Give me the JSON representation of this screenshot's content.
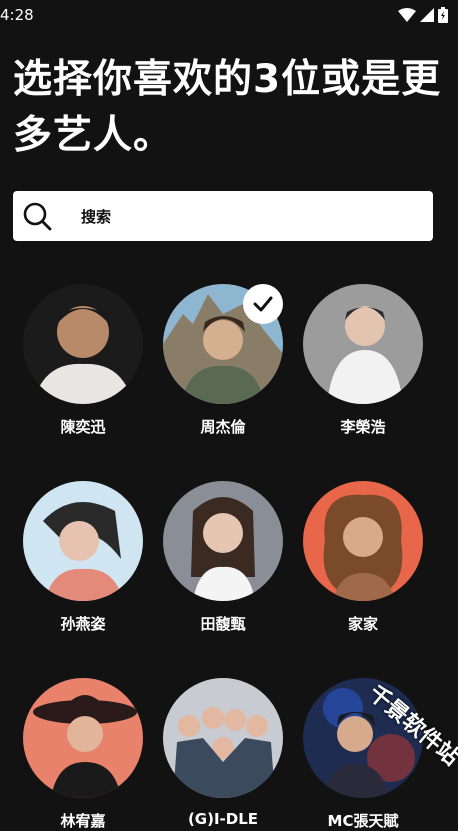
{
  "status": {
    "time": "4:28"
  },
  "title": "选择你喜欢的3位或是更多艺人。",
  "search": {
    "placeholder": "搜索"
  },
  "artists": [
    {
      "name": "陳奕迅",
      "selected": false
    },
    {
      "name": "周杰倫",
      "selected": true
    },
    {
      "name": "李榮浩",
      "selected": false
    },
    {
      "name": "孙燕姿",
      "selected": false
    },
    {
      "name": "田馥甄",
      "selected": false
    },
    {
      "name": "家家",
      "selected": false
    },
    {
      "name": "林宥嘉",
      "selected": false
    },
    {
      "name": "(G)I-DLE",
      "selected": false
    },
    {
      "name": "MC張天賦",
      "selected": false
    }
  ],
  "watermark": "千景软件站",
  "colors": {
    "background": "#121212",
    "search_bg": "#ffffff",
    "text": "#ffffff"
  }
}
